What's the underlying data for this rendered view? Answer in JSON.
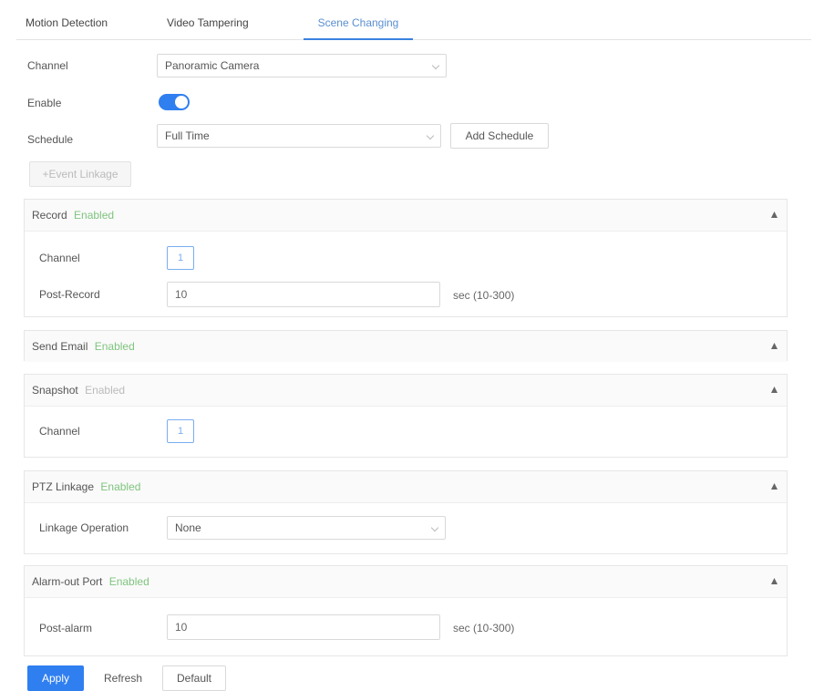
{
  "tabs": [
    {
      "label": "Motion Detection"
    },
    {
      "label": "Video Tampering"
    },
    {
      "label": "Scene Changing"
    }
  ],
  "form": {
    "channel_label": "Channel",
    "channel_value": "Panoramic Camera",
    "enable_label": "Enable",
    "enable_on": true,
    "schedule_label": "Schedule",
    "schedule_value": "Full Time",
    "add_schedule_label": "Add Schedule",
    "action_label": "+Event Linkage"
  },
  "sections": {
    "record": {
      "title": "Record",
      "status": "Enabled",
      "channel_label": "Channel",
      "channel_value": "1",
      "post_label": "Post-Record",
      "post_value": "10",
      "post_unit": "sec (10-300)"
    },
    "email": {
      "title": "Send Email",
      "status": "Enabled"
    },
    "snapshot": {
      "title": "Snapshot",
      "status": "Enabled",
      "channel_label": "Channel",
      "channel_value": "1"
    },
    "ptz": {
      "title": "PTZ Linkage",
      "status": "Enabled",
      "op_label": "Linkage Operation",
      "op_value": "None"
    },
    "alarm": {
      "title": "Alarm-out Port",
      "status": "Enabled",
      "post_label": "Post-alarm",
      "post_value": "10",
      "post_unit": "sec (10-300)"
    }
  },
  "footer": {
    "apply": "Apply",
    "refresh": "Refresh",
    "default": "Default"
  },
  "colors": {
    "accent": "#2f7ff0",
    "enabled": "#7fc47f"
  }
}
